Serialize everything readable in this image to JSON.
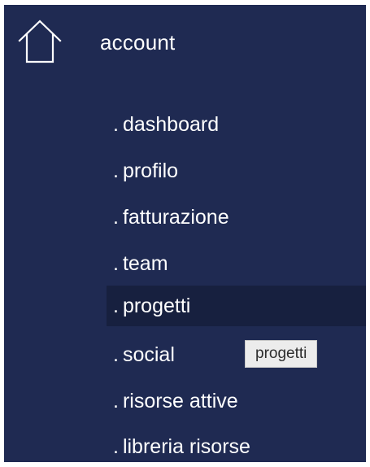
{
  "header": {
    "icon": "home-icon",
    "title": "account"
  },
  "menu": {
    "active_index": 4,
    "items": [
      {
        "prefix": ".",
        "label": "dashboard"
      },
      {
        "prefix": ".",
        "label": "profilo"
      },
      {
        "prefix": ".",
        "label": "fatturazione"
      },
      {
        "prefix": ".",
        "label": "team"
      },
      {
        "prefix": ".",
        "label": "progetti"
      },
      {
        "prefix": ".",
        "label": "social"
      },
      {
        "prefix": ".",
        "label": "risorse attive"
      },
      {
        "prefix": ".",
        "label": "libreria risorse"
      }
    ]
  },
  "tooltip": {
    "text": "progetti"
  },
  "colors": {
    "panel_bg": "#1f2a52",
    "active_bg": "#17203f",
    "text": "#ffffff",
    "tooltip_bg": "#ececec"
  }
}
